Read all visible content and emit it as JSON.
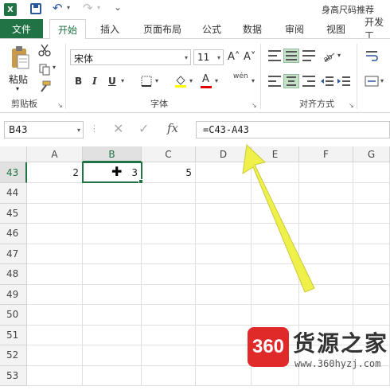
{
  "app": {
    "logo": "X",
    "window_title": "身高尺码推荐"
  },
  "qat": {
    "save": "save-icon",
    "undo": "↶",
    "redo": "↷",
    "dropdown": "▾",
    "customize": "⌄"
  },
  "tabs": [
    {
      "label": "文件"
    },
    {
      "label": "开始"
    },
    {
      "label": "插入"
    },
    {
      "label": "页面布局"
    },
    {
      "label": "公式"
    },
    {
      "label": "数据"
    },
    {
      "label": "审阅"
    },
    {
      "label": "视图"
    },
    {
      "label": "开发工"
    }
  ],
  "ribbon": {
    "clipboard": {
      "paste_label": "粘贴",
      "group_label": "剪贴板",
      "dropdown": "▾"
    },
    "font": {
      "name": "宋体",
      "size": "11",
      "grow": "A˄",
      "shrink": "A˅",
      "bold": "B",
      "italic": "I",
      "underline": "U",
      "group_label": "字体",
      "phonetic": "wén"
    },
    "alignment": {
      "group_label": "对齐方式"
    },
    "launcher": "↘"
  },
  "formula_bar": {
    "name_box": "B43",
    "cancel": "✕",
    "enter": "✓",
    "fx": "fx",
    "formula": "=C43-A43"
  },
  "sheet": {
    "columns": [
      "A",
      "B",
      "C",
      "D",
      "E",
      "F",
      "G"
    ],
    "rows": [
      "43",
      "44",
      "45",
      "46",
      "47",
      "48",
      "49",
      "50",
      "51",
      "52",
      "53"
    ],
    "cells": {
      "A43": "2",
      "B43": "3",
      "C43": "5"
    },
    "selected": {
      "col": "B",
      "row": "43"
    }
  },
  "watermark": {
    "logo": "360",
    "brand": "货源之家",
    "url": "www.360hyzj.com"
  },
  "colors": {
    "excel_green": "#217346",
    "arrow_yellow": "#f0f04a",
    "watermark_red": "#e02a2a"
  }
}
